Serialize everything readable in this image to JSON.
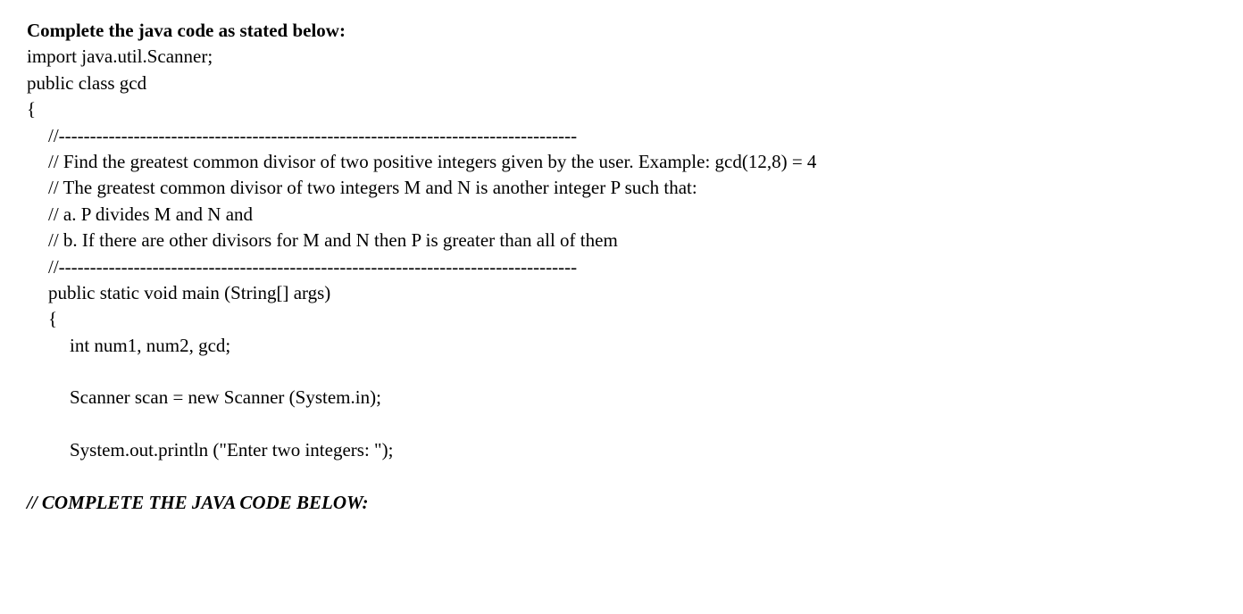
{
  "lines": {
    "l1": "Complete the java code as stated below:",
    "l2": "import java.util.Scanner;",
    "l3": "public class gcd",
    "l4": "{",
    "l5": "//-----------------------------------------------------------------------------------",
    "l6": "//  Find the greatest common divisor of two positive integers given by the user.  Example: gcd(12,8) = 4",
    "l7": "// The greatest common divisor of two integers M and N is another integer P such that:",
    "l8": "// a.    P divides M and N and",
    "l9": "// b.    If there are other divisors for M and N then P is greater than all of them",
    "l10": "//-----------------------------------------------------------------------------------",
    "l11": "public static void main (String[] args)",
    "l12": "{",
    "l13": "int num1, num2, gcd;",
    "l14": "Scanner scan = new Scanner (System.in);",
    "l15": "System.out.println (\"Enter two integers: \");",
    "l16": "// COMPLETE THE JAVA CODE BELOW:"
  }
}
